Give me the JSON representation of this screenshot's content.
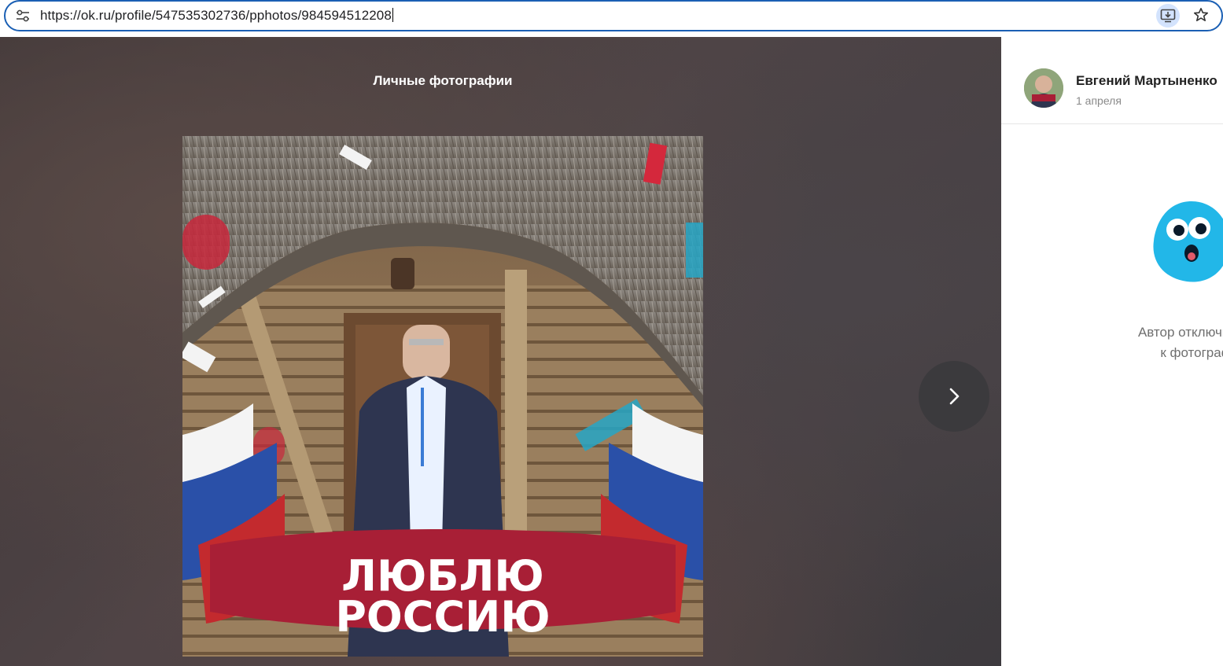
{
  "browser": {
    "url": "https://ok.ru/profile/547535302736/pphotos/984594512208",
    "icons": {
      "site_info": "tune-icon",
      "install": "install-app-icon",
      "bookmark": "star-icon"
    },
    "accent_color": "#1a5fb4"
  },
  "viewer": {
    "album_title": "Личные фотографии",
    "photo": {
      "banner_line1": "ЛЮБЛЮ",
      "banner_line2": "РОССИЮ"
    },
    "next_icon": "chevron-right-icon"
  },
  "sidebar": {
    "author_name": "Евгений Мартыненко",
    "date": "1 апреля",
    "mascot_icon": "surprised-face-icon",
    "comments_disabled_line1": "Автор отключил ко",
    "comments_disabled_line2": "к фотограф"
  }
}
